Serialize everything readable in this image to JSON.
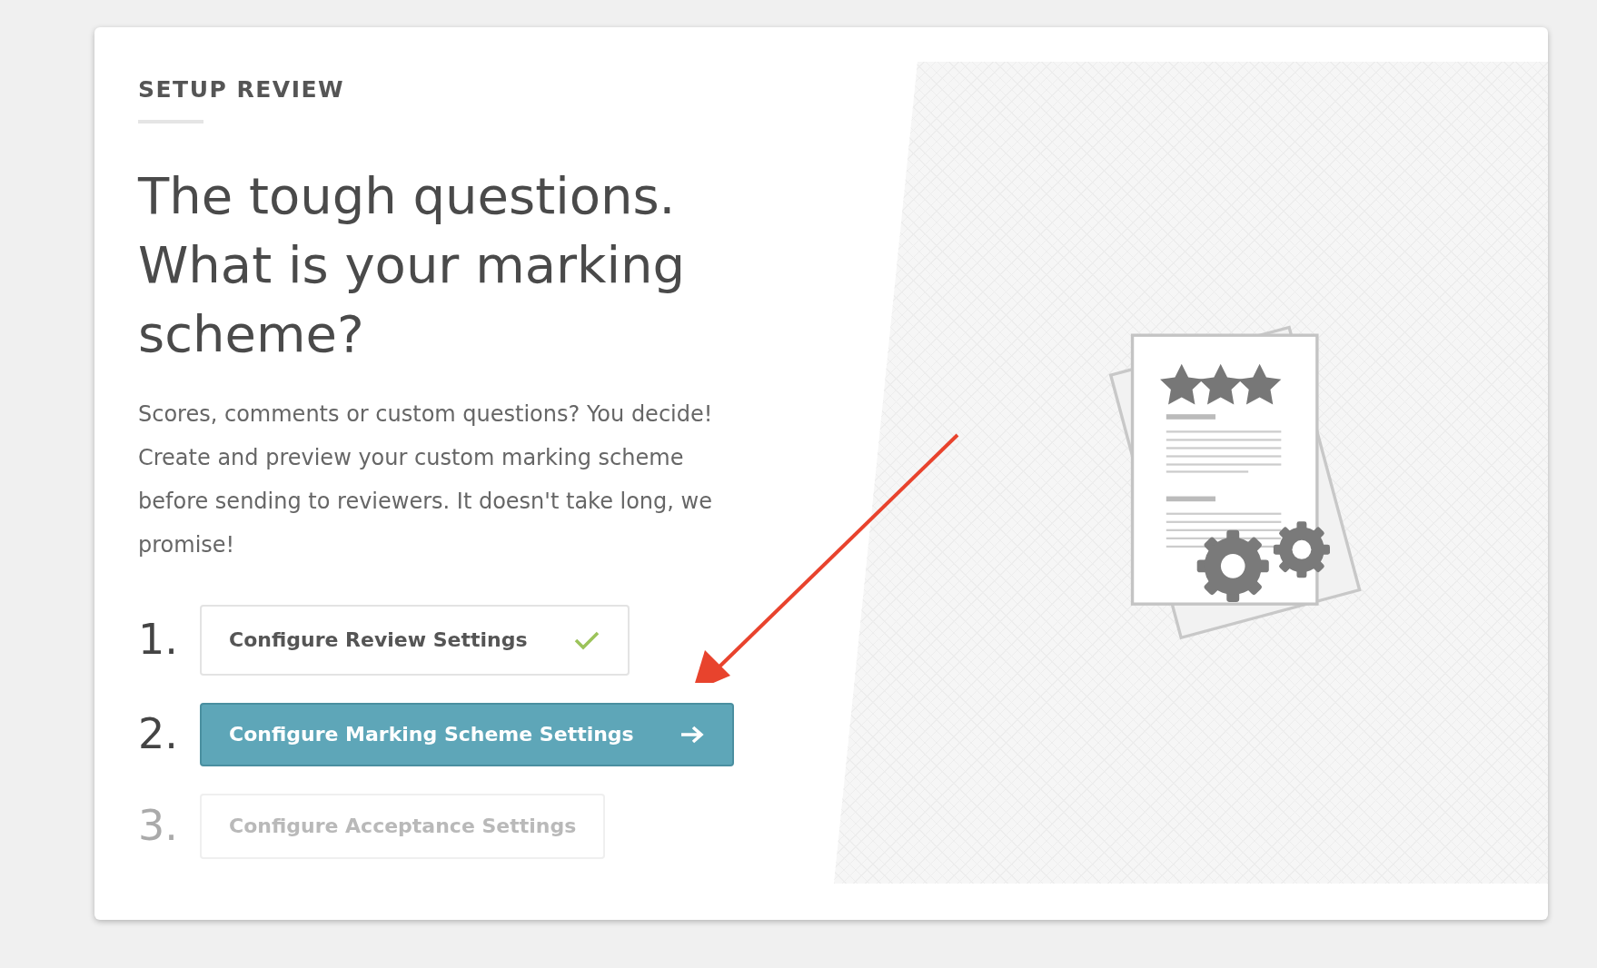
{
  "section_label": "SETUP REVIEW",
  "headline": [
    "The tough questions.",
    "What is your marking",
    "scheme?"
  ],
  "description": "Scores, comments or custom questions? You decide! Create and preview your custom marking scheme before sending to reviewers. It doesn't take long, we promise!",
  "steps": [
    {
      "number": "1.",
      "label": "Configure Review Settings",
      "completed": true,
      "selected": false,
      "disabled": false
    },
    {
      "number": "2.",
      "label": "Configure Marking Scheme Settings",
      "completed": false,
      "selected": true,
      "disabled": false
    },
    {
      "number": "3.",
      "label": "Configure Acceptance Settings",
      "completed": false,
      "selected": false,
      "disabled": true
    }
  ]
}
